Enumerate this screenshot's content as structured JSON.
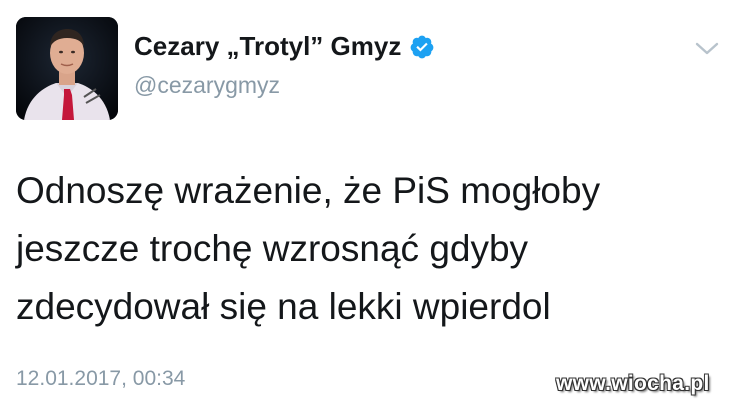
{
  "tweet": {
    "author": {
      "display_name": "Cezary „Trotyl” Gmyz",
      "handle": "@cezarygmyz",
      "verified": true,
      "verified_icon": "verified-badge-icon"
    },
    "menu_icon": "chevron-down-icon",
    "text_lines": [
      "Odnoszę wrażenie, że PiS mogłoby",
      "jeszcze trochę wzrosnąć gdyby",
      "zdecydował się na lekki wpierdol"
    ],
    "timestamp": "12.01.2017, 00:34"
  },
  "watermark": "www.wiocha.pl",
  "colors": {
    "text": "#14171a",
    "secondary_text": "#8899a6",
    "verified_blue": "#1da1f2",
    "background": "#ffffff"
  }
}
